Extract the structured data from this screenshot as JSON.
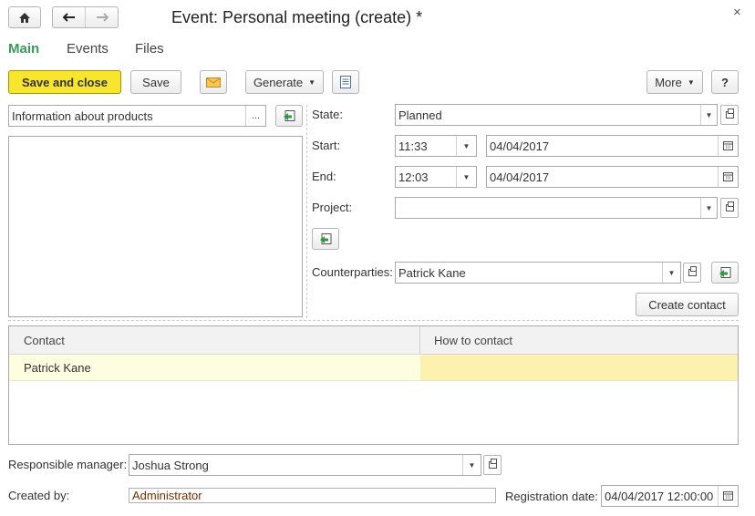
{
  "window": {
    "title": "Event: Personal meeting (create) *",
    "close_glyph": "×"
  },
  "tabs": [
    {
      "label": "Main",
      "active": true
    },
    {
      "label": "Events",
      "active": false
    },
    {
      "label": "Files",
      "active": false
    }
  ],
  "toolbar": {
    "save_close_label": "Save and close",
    "save_label": "Save",
    "generate_label": "Generate",
    "more_label": "More",
    "help_label": "?"
  },
  "subject": {
    "value": "Information about products",
    "ellipsis": "..."
  },
  "form": {
    "state_label": "State:",
    "state_value": "Planned",
    "start_label": "Start:",
    "start_time": "11:33",
    "start_date": "04/04/2017",
    "end_label": "End:",
    "end_time": "12:03",
    "end_date": "04/04/2017",
    "project_label": "Project:",
    "project_value": "",
    "counterparties_label": "Counterparties:",
    "counterparties_value": "Patrick Kane",
    "create_contact_label": "Create contact"
  },
  "contacts_table": {
    "headers": [
      "Contact",
      "How to contact"
    ],
    "rows": [
      {
        "contact": "Patrick Kane",
        "how": ""
      }
    ]
  },
  "footer": {
    "manager_label": "Responsible manager:",
    "manager_value": "Joshua Strong",
    "created_by_label": "Created by:",
    "created_by_value": "Administrator",
    "reg_date_label": "Registration date:",
    "reg_date_value": "04/04/2017 12:00:00"
  },
  "colors": {
    "accent_green": "#3a9a5b",
    "primary_yellow": "#f7e52e",
    "row_highlight": "#fdfde0",
    "cell_highlight": "#fdf1b0",
    "created_by_text": "#7a2e00"
  }
}
